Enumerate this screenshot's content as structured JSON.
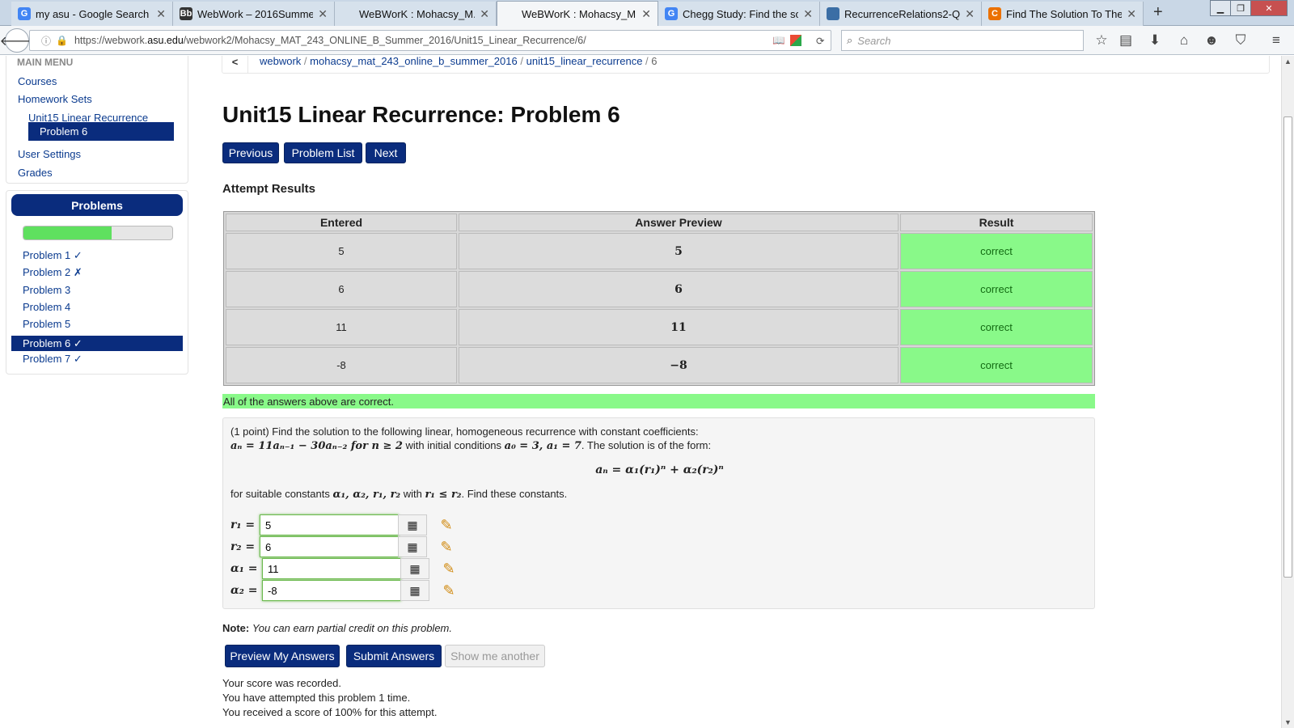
{
  "browser": {
    "tabs": [
      {
        "title": "my asu - Google Search",
        "icon": "google-icon",
        "fav": "G",
        "color": "#4285f4"
      },
      {
        "title": "WebWork – 2016Summer...",
        "icon": "blackboard-icon",
        "fav": "Bb",
        "color": "#333333"
      },
      {
        "title": "WeBWorK : Mohacsy_M...",
        "icon": "blank-icon",
        "fav": "",
        "color": "#d6e1ec"
      },
      {
        "title": "WeBWorK : Mohacsy_M...",
        "icon": "blank-icon",
        "fav": "",
        "color": "#f4f6f8"
      },
      {
        "title": "Chegg Study: Find the so...",
        "icon": "google-icon",
        "fav": "G",
        "color": "#4285f4"
      },
      {
        "title": "RecurrenceRelations2-Q...",
        "icon": "document-icon",
        "fav": "",
        "color": "#3b6ea5"
      },
      {
        "title": "Find The Solution To The...",
        "icon": "chegg-icon",
        "fav": "C",
        "color": "#eb7100"
      }
    ],
    "url_prefix": "https://webwork.",
    "url_host": "asu.edu",
    "url_path": "/webwork2/Mohacsy_MAT_243_ONLINE_B_Summer_2016/Unit15_Linear_Recurrence/6/",
    "search_placeholder": "Search"
  },
  "breadcrumb": {
    "items": [
      "webwork",
      "mohacsy_mat_243_online_b_summer_2016",
      "unit15_linear_recurrence"
    ],
    "current": "6",
    "sep": "/"
  },
  "sidebar": {
    "heading": "MAIN MENU",
    "items": {
      "courses": "Courses",
      "homework_sets": "Homework Sets",
      "unit": "Unit15 Linear Recurrence",
      "problem": "Problem 6",
      "user_settings": "User Settings",
      "grades": "Grades"
    },
    "problems_title": "Problems",
    "progress_fraction": 0.59,
    "problems": [
      {
        "label": "Problem 1 ✓",
        "selected": false
      },
      {
        "label": "Problem 2 ✗",
        "selected": false
      },
      {
        "label": "Problem 3",
        "selected": false
      },
      {
        "label": "Problem 4",
        "selected": false
      },
      {
        "label": "Problem 5",
        "selected": false
      },
      {
        "label": "Problem 6 ✓",
        "selected": true
      },
      {
        "label": "Problem 7 ✓",
        "selected": false
      }
    ]
  },
  "page": {
    "title": "Unit15 Linear Recurrence: Problem 6",
    "buttons": {
      "previous": "Previous",
      "problem_list": "Problem List",
      "next": "Next"
    },
    "attempt_heading": "Attempt Results",
    "table": {
      "headers": [
        "Entered",
        "Answer Preview",
        "Result"
      ],
      "rows": [
        {
          "entered": "5",
          "preview": "5",
          "result": "correct"
        },
        {
          "entered": "6",
          "preview": "6",
          "result": "correct"
        },
        {
          "entered": "11",
          "preview": "11",
          "result": "correct"
        },
        {
          "entered": "-8",
          "preview": "−8",
          "result": "correct"
        }
      ]
    },
    "all_correct": "All of the answers above are correct.",
    "problem": {
      "intro": "(1 point) Find the solution to the following linear, homogeneous recurrence with constant coefficients:",
      "recurrence": "aₙ = 11aₙ₋₁ − 30aₙ₋₂ for n ≥ 2",
      "conditions_text": " with initial conditions ",
      "conditions": "a₀ = 3, a₁ = 7",
      "form_text": ". The solution is of the form:",
      "form": "aₙ = α₁(r₁)ⁿ + α₂(r₂)ⁿ",
      "constants_text": "for suitable constants ",
      "constants": "α₁, α₂, r₁, r₂",
      "with_text": " with ",
      "constraint": "r₁ ≤ r₂",
      "find_text": ". Find these constants."
    },
    "answers": [
      {
        "label": "r₁ =",
        "value": "5"
      },
      {
        "label": "r₂ =",
        "value": "6"
      },
      {
        "label": "α₁ =",
        "value": "11"
      },
      {
        "label": "α₂ =",
        "value": "-8"
      }
    ],
    "note_label": "Note:",
    "note_text": "You can earn partial credit on this problem.",
    "action_buttons": {
      "preview": "Preview My Answers",
      "submit": "Submit Answers",
      "show_another": "Show me another"
    },
    "score_lines": [
      "Your score was recorded.",
      "You have attempted this problem 1 time.",
      "You received a score of 100% for this attempt."
    ]
  }
}
